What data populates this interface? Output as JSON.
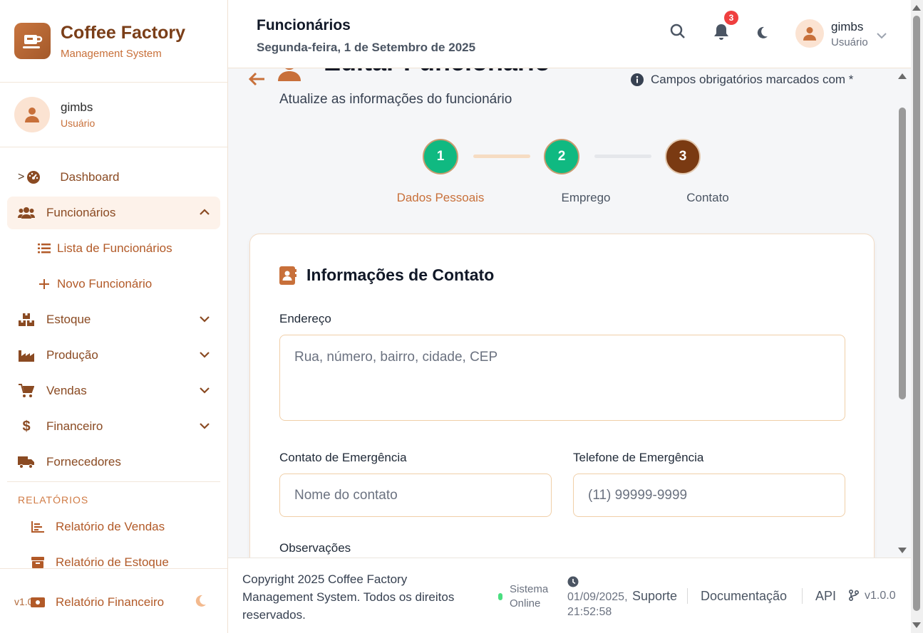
{
  "brand": {
    "title": "Coffee Factory",
    "subtitle": "Management System"
  },
  "sidebar": {
    "user": {
      "name": "gimbs",
      "role": "Usuário"
    },
    "prefix_marker": ">",
    "items": [
      {
        "label": "Dashboard",
        "icon": "gauge-icon"
      },
      {
        "label": "Funcionários",
        "icon": "users-icon",
        "expanded": true,
        "children": [
          {
            "label": "Lista de Funcionários",
            "icon": "list-icon"
          },
          {
            "label": "Novo Funcionário",
            "icon": "plus-icon"
          }
        ]
      },
      {
        "label": "Estoque",
        "icon": "boxes-icon"
      },
      {
        "label": "Produção",
        "icon": "industry-icon"
      },
      {
        "label": "Vendas",
        "icon": "cart-icon"
      },
      {
        "label": "Financeiro",
        "icon": "dollar-icon"
      },
      {
        "label": "Fornecedores",
        "icon": "truck-icon"
      }
    ],
    "reports_section": "RELATÓRIOS",
    "reports": [
      {
        "label": "Relatório de Vendas",
        "icon": "chart-bar-icon"
      },
      {
        "label": "Relatório de Estoque",
        "icon": "archive-icon"
      },
      {
        "label": "Relatório Financeiro",
        "icon": "money-bill-icon"
      }
    ],
    "version": "v1.0"
  },
  "header": {
    "title": "Funcionários",
    "date": "Segunda-feira, 1 de Setembro de 2025",
    "notification_count": "3",
    "user": {
      "name": "gimbs",
      "role": "Usuário"
    }
  },
  "page": {
    "title": "Editar Funcionário",
    "subtitle": "Atualize as informações do funcionário",
    "required_note": "Campos obrigatórios marcados com *",
    "steps": [
      {
        "number": "1",
        "label": "Dados Pessoais",
        "state": "done"
      },
      {
        "number": "2",
        "label": "Emprego",
        "state": "done"
      },
      {
        "number": "3",
        "label": "Contato",
        "state": "current"
      }
    ],
    "section_title": "Informações de Contato",
    "fields": {
      "address_label": "Endereço",
      "address_placeholder": "Rua, número, bairro, cidade, CEP",
      "emergency_contact_label": "Contato de Emergência",
      "emergency_contact_placeholder": "Nome do contato",
      "emergency_phone_label": "Telefone de Emergência",
      "emergency_phone_placeholder": "(11) 99999-9999",
      "notes_label": "Observações"
    }
  },
  "footer": {
    "copyright": "Copyright 2025 Coffee Factory Management System. Todos os direitos reservados.",
    "status": "Sistema Online",
    "datetime": "01/09/2025, 21:52:58",
    "links": [
      "Suporte",
      "Documentação",
      "API"
    ],
    "version": "v1.0.0"
  },
  "colors": {
    "accent": "#c8703a",
    "brand_dark": "#7a3e18",
    "success": "#10b981",
    "step_current": "#7a3a12",
    "badge": "#ef3f3f"
  }
}
